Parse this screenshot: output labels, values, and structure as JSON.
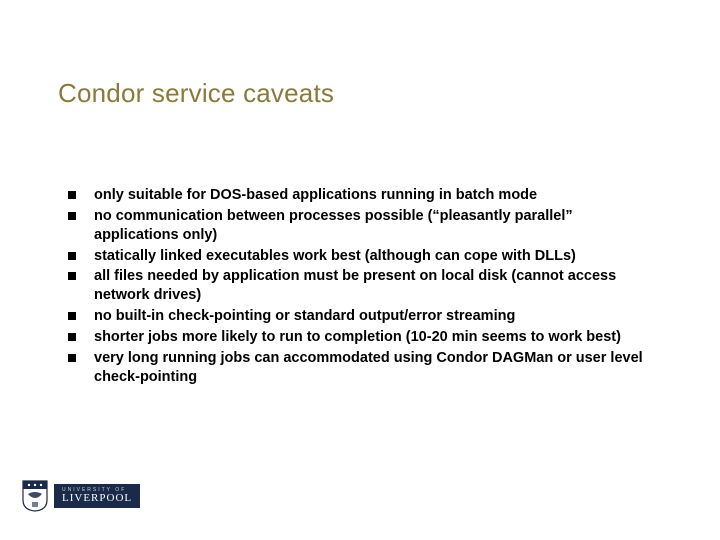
{
  "slide": {
    "title": "Condor service caveats",
    "bullets": [
      "only suitable for DOS-based applications running in batch mode",
      "no communication between processes possible (“pleasantly parallel” applications only)",
      "statically linked executables work best (although can cope with DLLs)",
      "all files needed by application must be present on local disk (cannot access network drives)",
      "no built-in check-pointing or standard output/error streaming",
      "shorter jobs more likely to run to completion (10-20 min seems to work best)",
      "very long running jobs can accommodated using Condor DAGMan or user level check-pointing"
    ]
  },
  "footer": {
    "org_top": "UNIVERSITY OF",
    "org_main": "LIVERPOOL"
  }
}
